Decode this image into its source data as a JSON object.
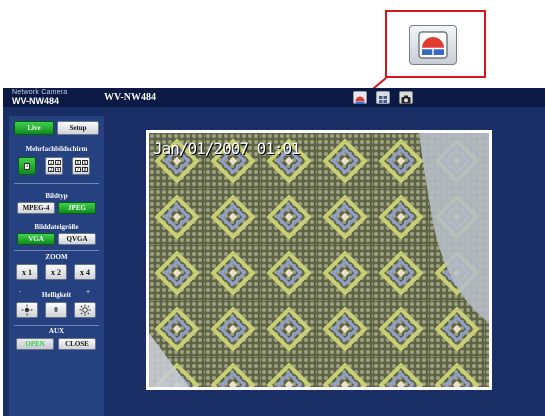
{
  "header": {
    "brand_line": "Network Camera",
    "brand_model": "WV-NW484",
    "page_title": "WV-NW484"
  },
  "tabs": {
    "live": "Live",
    "setup": "Setup"
  },
  "multiscreen": {
    "label": "Mehrfachbildschirm",
    "single": "1",
    "quad_a": [
      "1",
      "2",
      "3",
      "4"
    ],
    "quad_b": [
      "5",
      "6",
      "7",
      "8"
    ]
  },
  "image_type": {
    "label": "Bildtyp",
    "mpeg4": "MPEG-4",
    "jpeg": "JPEG"
  },
  "image_size": {
    "label": "Bilddateigröße",
    "vga": "VGA",
    "qvga": "QVGA"
  },
  "zoom": {
    "label": "ZOOM",
    "x1": "x 1",
    "x2": "x 2",
    "x4": "x 4"
  },
  "brightness": {
    "label": "Helligkeit",
    "minus": "-",
    "plus": "+",
    "reset": "0"
  },
  "aux": {
    "label": "AUX",
    "open": "OPEN",
    "close": "CLOSE"
  },
  "video": {
    "timestamp": "Jan/01/2007 01:01"
  },
  "colors": {
    "callout_border": "#d8141c",
    "panel_bg": "#1a2f66",
    "sidebar_bg": "#25417f",
    "active_green": "#1aa82a"
  },
  "icons": {
    "callout": "sd-record-icon",
    "toolbar": [
      "sd-record-icon",
      "multiscreen-icon",
      "snapshot-camera-icon"
    ]
  }
}
